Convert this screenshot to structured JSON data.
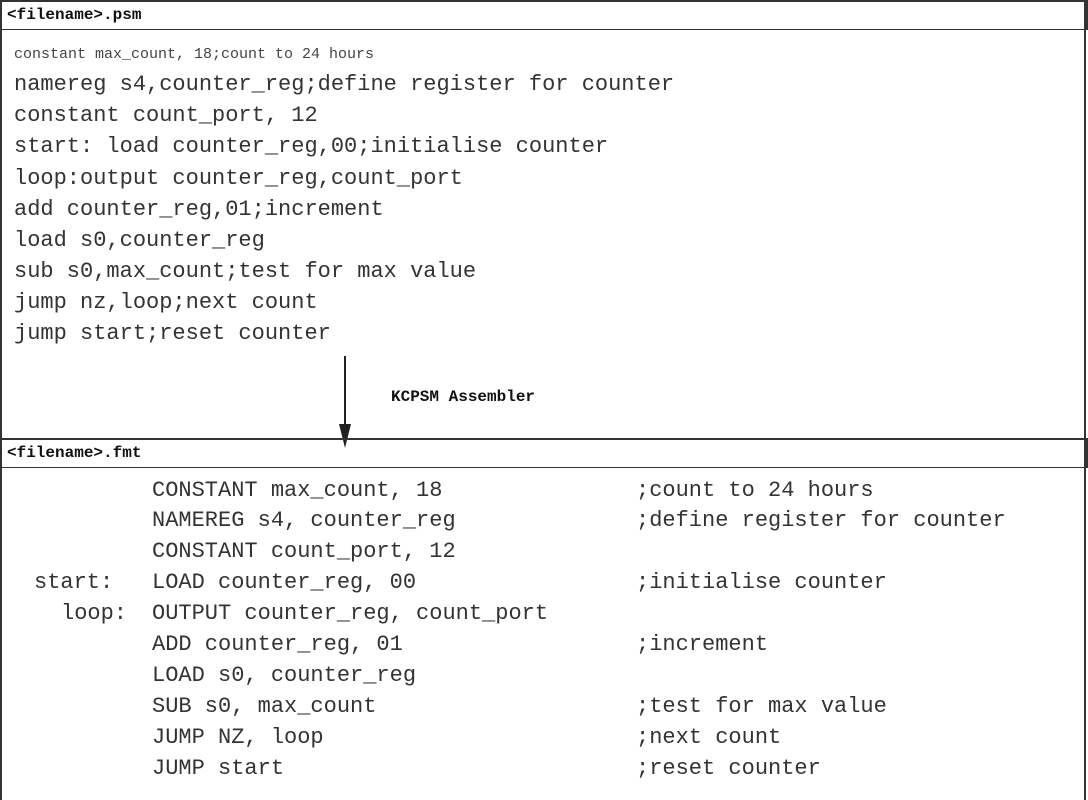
{
  "psm": {
    "filename_label": "<filename>.psm",
    "lines": [
      "constant max_count, 18;count to 24 hours",
      "namereg s4,counter_reg;define register for counter",
      "constant count_port, 12",
      "start: load counter_reg,00;initialise counter",
      "loop:output counter_reg,count_port",
      "add counter_reg,01;increment",
      "load s0,counter_reg",
      "sub s0,max_count;test for max value",
      "jump nz,loop;next count",
      "jump start;reset counter"
    ]
  },
  "assembler": {
    "label": "KCPSM Assembler"
  },
  "fmt": {
    "filename_label": "<filename>.fmt",
    "lines": [
      {
        "label": "",
        "instruction": "CONSTANT max_count, 18",
        "comment": ";count to 24 hours"
      },
      {
        "label": "",
        "instruction": "NAMEREG s4, counter_reg",
        "comment": ";define register for counter"
      },
      {
        "label": "",
        "instruction": "CONSTANT count_port, 12",
        "comment": ""
      },
      {
        "label": "start:",
        "instruction": "LOAD counter_reg, 00",
        "comment": ";initialise counter"
      },
      {
        "label": "loop:",
        "instruction": "OUTPUT counter_reg, count_port",
        "comment": ""
      },
      {
        "label": "",
        "instruction": "ADD counter_reg, 01",
        "comment": ";increment"
      },
      {
        "label": "",
        "instruction": "LOAD s0, counter_reg",
        "comment": ""
      },
      {
        "label": "",
        "instruction": "SUB s0, max_count",
        "comment": ";test for max value"
      },
      {
        "label": "",
        "instruction": "JUMP NZ, loop",
        "comment": ";next count"
      },
      {
        "label": "",
        "instruction": "JUMP start",
        "comment": ";reset counter"
      }
    ]
  }
}
